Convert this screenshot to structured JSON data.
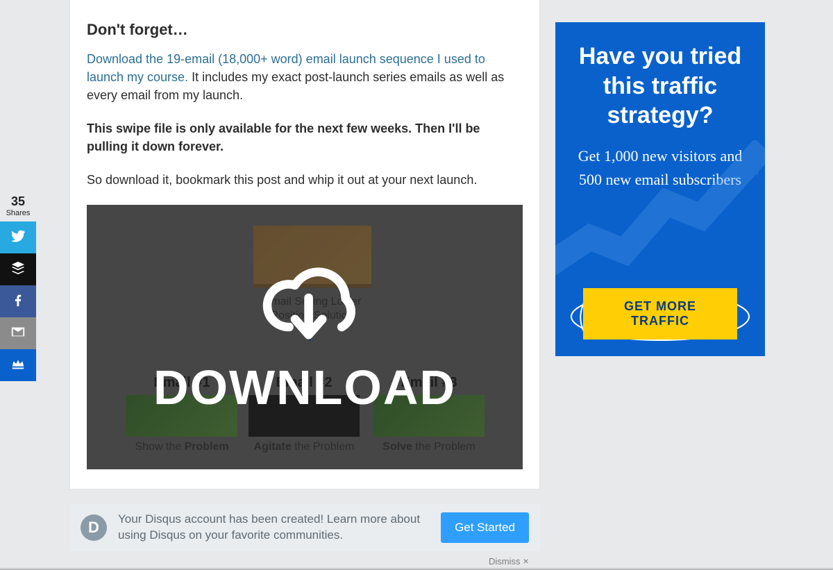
{
  "share": {
    "count": "35",
    "count_label": "Shares"
  },
  "article": {
    "heading": "Don't forget…",
    "link_text": "Download the 19-email (18,000+ word) email launch sequence I used to launch my course.",
    "after_link": "  It includes my exact post-launch series emails as well as every email from my launch.",
    "bold_para": "This swipe file is only available for the next few weeks. Then I'll be pulling it down forever.",
    "closing": "So download it, bookmark this post and whip it out at your next launch."
  },
  "hero": {
    "bg_label_line1": "Email Selling Lower",
    "bg_label_line2": "Position Solution",
    "overlay_word": "DOWNLOAD",
    "emails": [
      {
        "num": "Email #1",
        "caption_pre": "Show the ",
        "caption_strong": "Problem"
      },
      {
        "num": "Email #2",
        "caption_pre": "Agitate",
        "caption_mid": " the Problem"
      },
      {
        "num": "Email #3",
        "caption_pre": "Solve",
        "caption_mid": " the Problem"
      }
    ]
  },
  "ad": {
    "headline": "Have you tried this traffic strategy?",
    "sub": "Get 1,000 new visitors and 500 new email subscribers",
    "cta": "GET MORE TRAFFIC"
  },
  "disqus": {
    "logo_letter": "D",
    "message": "Your Disqus account has been created! Learn more about using Disqus on your favorite communities.",
    "cta": "Get Started"
  },
  "dismiss": {
    "label": "Dismiss",
    "x": "×"
  }
}
